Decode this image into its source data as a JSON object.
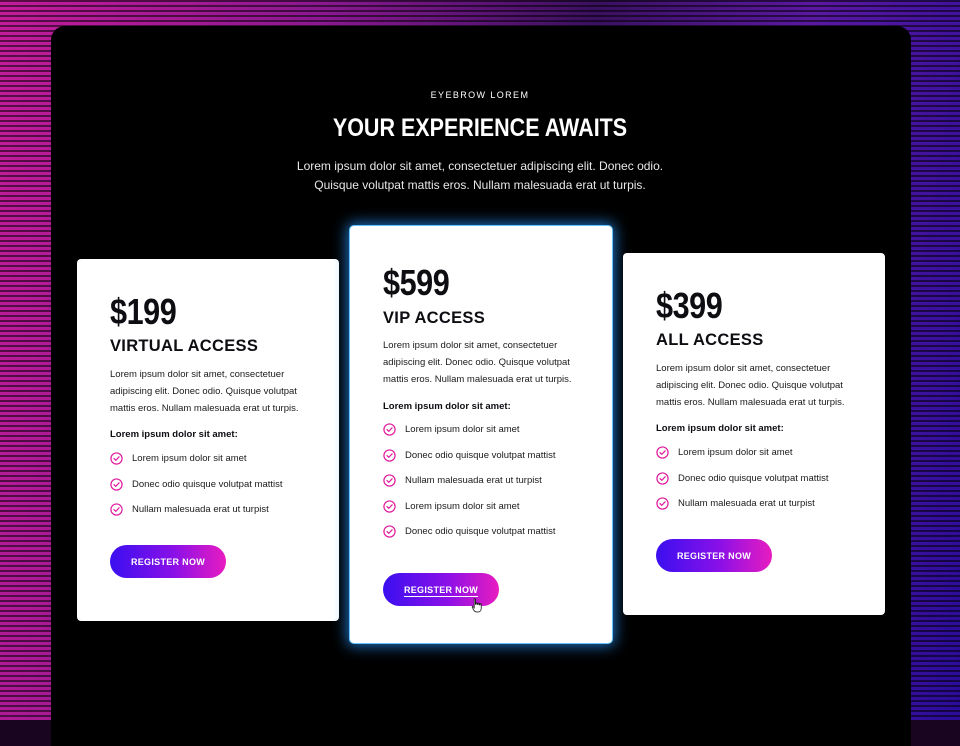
{
  "header": {
    "eyebrow": "EYEBROW LOREM",
    "title": "YOUR EXPERIENCE AWAITS",
    "subtitle": "Lorem ipsum dolor sit amet, consectetuer adipiscing elit. Donec odio. Quisque volutpat mattis eros. Nullam malesuada erat ut turpis."
  },
  "cards": [
    {
      "price": "$199",
      "plan": "VIRTUAL ACCESS",
      "description": "Lorem ipsum dolor sit amet, consectetuer adipiscing elit. Donec odio. Quisque volutpat mattis eros. Nullam malesuada erat ut turpis.",
      "features_title": "Lorem ipsum dolor sit amet:",
      "features": [
        "Lorem ipsum dolor sit amet",
        "Donec odio quisque volutpat mattist",
        "Nullam malesuada erat ut turpist"
      ],
      "button_label": "REGISTER NOW"
    },
    {
      "price": "$599",
      "plan": "VIP ACCESS",
      "description": "Lorem ipsum dolor sit amet, consectetuer adipiscing elit. Donec odio. Quisque volutpat mattis eros. Nullam malesuada erat ut turpis.",
      "features_title": "Lorem ipsum dolor sit amet:",
      "features": [
        "Lorem ipsum dolor sit amet",
        "Donec odio quisque volutpat mattist",
        "Nullam malesuada erat ut turpist",
        "Lorem ipsum dolor sit amet",
        "Donec odio quisque volutpat mattist"
      ],
      "button_label": "REGISTER NOW"
    },
    {
      "price": "$399",
      "plan": "ALL ACCESS",
      "description": "Lorem ipsum dolor sit amet, consectetuer adipiscing elit. Donec odio. Quisque volutpat mattis eros. Nullam malesuada erat ut turpis.",
      "features_title": "Lorem ipsum dolor sit amet:",
      "features": [
        "Lorem ipsum dolor sit amet",
        "Donec odio quisque volutpat mattist",
        "Nullam malesuada erat ut turpist"
      ],
      "button_label": "REGISTER NOW"
    }
  ],
  "colors": {
    "check_icon": "#e0199c",
    "button_gradient_start": "#3b0ff0",
    "button_gradient_end": "#e81cc0",
    "highlight_glow": "#2896ff"
  },
  "icons": {
    "feature": "check-circle-icon",
    "cursor": "hand-pointer-icon"
  }
}
